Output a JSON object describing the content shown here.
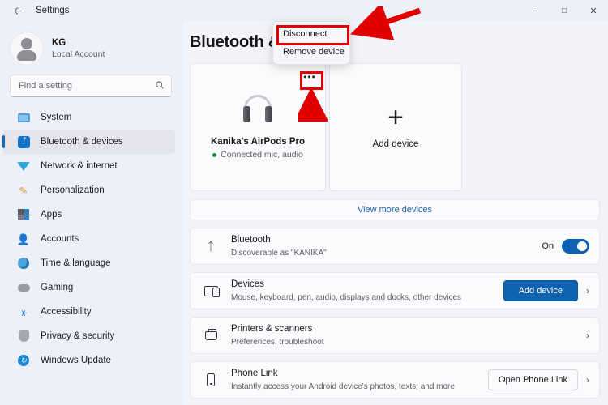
{
  "window": {
    "title": "Settings",
    "back_icon": "back-arrow-icon",
    "minimize": "–",
    "maximize": "□",
    "close": "✕"
  },
  "sidebar": {
    "account": {
      "name": "KG",
      "subtitle": "Local Account"
    },
    "search": {
      "placeholder": "Find a setting",
      "value": "",
      "icon": "search-icon"
    },
    "items": [
      {
        "label": "System",
        "icon": "system-icon",
        "active": false
      },
      {
        "label": "Bluetooth & devices",
        "icon": "bluetooth-icon",
        "active": true
      },
      {
        "label": "Network & internet",
        "icon": "network-icon",
        "active": false
      },
      {
        "label": "Personalization",
        "icon": "paintbrush-icon",
        "active": false
      },
      {
        "label": "Apps",
        "icon": "apps-icon",
        "active": false
      },
      {
        "label": "Accounts",
        "icon": "accounts-icon",
        "active": false
      },
      {
        "label": "Time & language",
        "icon": "clock-icon",
        "active": false
      },
      {
        "label": "Gaming",
        "icon": "gamepad-icon",
        "active": false
      },
      {
        "label": "Accessibility",
        "icon": "accessibility-icon",
        "active": false
      },
      {
        "label": "Privacy & security",
        "icon": "shield-icon",
        "active": false
      },
      {
        "label": "Windows Update",
        "icon": "update-icon",
        "active": false
      }
    ]
  },
  "main": {
    "page_title": "Bluetooth &",
    "device_card": {
      "name": "Kanika's AirPods Pro",
      "status": "Connected mic, audio",
      "status_color": "#1d8a3a",
      "more_button": "•••",
      "icon": "headphones-icon"
    },
    "add_card": {
      "label": "Add device",
      "icon": "plus-icon"
    },
    "view_more": "View more devices",
    "rows": [
      {
        "title": "Bluetooth",
        "subtitle": "Discoverable as \"KANIKA\"",
        "icon": "bluetooth-icon",
        "toggle_label": "On",
        "toggle_on": true
      },
      {
        "title": "Devices",
        "subtitle": "Mouse, keyboard, pen, audio, displays and docks, other devices",
        "icon": "devices-icon",
        "button": "Add device",
        "chevron": "›"
      },
      {
        "title": "Printers & scanners",
        "subtitle": "Preferences, troubleshoot",
        "icon": "printer-icon",
        "chevron": "›"
      },
      {
        "title": "Phone Link",
        "subtitle": "Instantly access your Android device's photos, texts, and more",
        "icon": "phone-icon",
        "button": "Open Phone Link",
        "chevron": "›"
      }
    ]
  },
  "context_menu": {
    "items": [
      {
        "label": "Disconnect",
        "highlighted": true
      },
      {
        "label": "Remove device",
        "highlighted": false
      }
    ]
  },
  "annotations": {
    "accent_color": "#e00000",
    "highlight_menu_item": "Disconnect",
    "highlight_target": "more-options-button"
  }
}
